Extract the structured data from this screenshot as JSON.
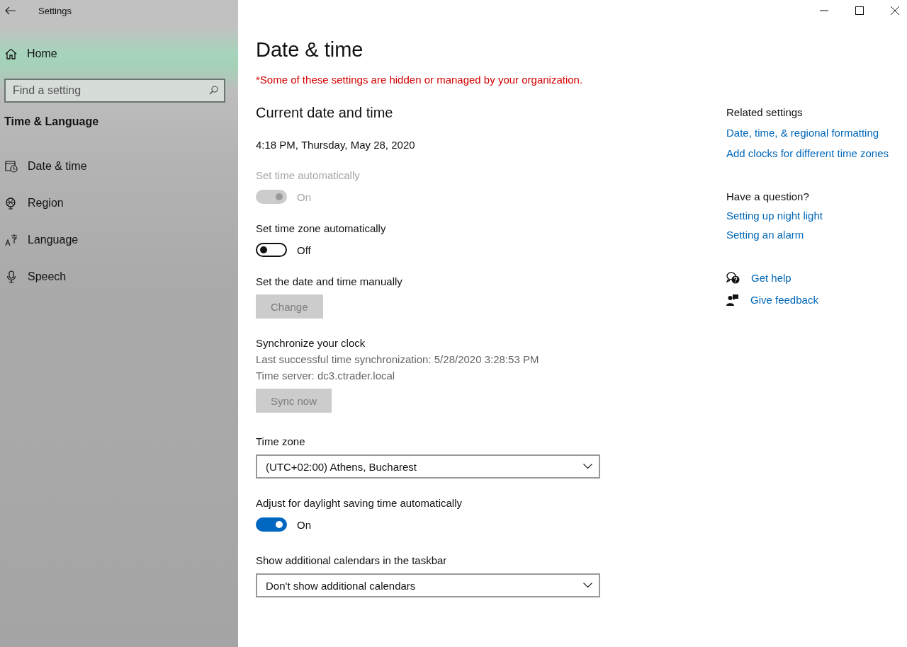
{
  "window": {
    "title": "Settings"
  },
  "sidebar": {
    "home": "Home",
    "search": {
      "placeholder": "Find a setting"
    },
    "section": "Time & Language",
    "items": [
      {
        "label": "Date & time"
      },
      {
        "label": "Region"
      },
      {
        "label": "Language"
      },
      {
        "label": "Speech"
      }
    ]
  },
  "main": {
    "title": "Date & time",
    "notice": "*Some of these settings are hidden or managed by your organization.",
    "heading": "Current date and time",
    "current": "4:18 PM, Thursday, May 28, 2020",
    "settings": [
      {
        "kind": "toggle",
        "label": "Set time automatically",
        "on": true,
        "disabled": true,
        "state": "On"
      },
      {
        "kind": "toggle",
        "label": "Set time zone automatically",
        "on": false,
        "disabled": false,
        "state": "Off"
      },
      {
        "kind": "button",
        "label": "Set the date and time manually",
        "button": "Change",
        "disabled": true
      },
      {
        "kind": "sync",
        "label": "Synchronize your clock",
        "lines": [
          "Last successful time synchronization: 5/28/2020 3:28:53 PM",
          "Time server: dc3.ctrader.local"
        ],
        "button": "Sync now",
        "disabled": true
      },
      {
        "kind": "dropdown",
        "label": "Time zone",
        "value": "(UTC+02:00) Athens, Bucharest"
      },
      {
        "kind": "toggle",
        "label": "Adjust for daylight saving time automatically",
        "on": true,
        "disabled": false,
        "state": "On"
      },
      {
        "kind": "dropdown",
        "label": "Show additional calendars in the taskbar",
        "value": "Don't show additional calendars"
      }
    ]
  },
  "aside": {
    "related": {
      "heading": "Related settings",
      "links": [
        "Date, time, & regional formatting",
        "Add clocks for different time zones"
      ]
    },
    "question": {
      "heading": "Have a question?",
      "links": [
        "Setting up night light",
        "Setting an alarm"
      ]
    },
    "help": [
      "Get help",
      "Give feedback"
    ]
  }
}
